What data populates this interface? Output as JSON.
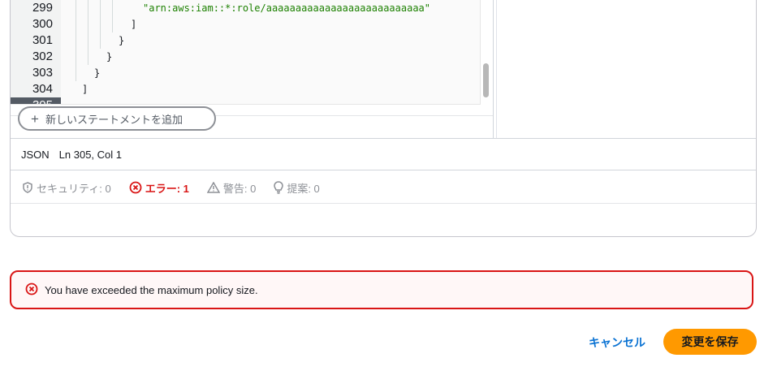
{
  "editor": {
    "line_numbers": [
      "299",
      "300",
      "301",
      "302",
      "303",
      "304",
      "305"
    ],
    "active_line": "305",
    "code_lines": [
      {
        "text": "\"arn:aws:iam::*:role/aaaaaaaaaaaaaaaaaaaaaaaaaaa\"",
        "type": "string"
      },
      {
        "text": "]",
        "type": "plain"
      },
      {
        "text": "}",
        "type": "plain"
      },
      {
        "text": "}",
        "type": "plain"
      },
      {
        "text": "}",
        "type": "plain"
      },
      {
        "text": "]",
        "type": "plain"
      },
      {
        "text": "",
        "type": "plain"
      }
    ],
    "add_statement_label": "新しいステートメントを追加"
  },
  "status_bar": {
    "language": "JSON",
    "cursor_position": "Ln 305, Col 1"
  },
  "validation": {
    "security": "セキュリティ: 0",
    "errors": "エラー: 1",
    "warnings": "警告: 0",
    "suggestions": "提案: 0"
  },
  "alert": {
    "message": "You have exceeded the maximum policy size."
  },
  "footer": {
    "cancel_label": "キャンセル",
    "save_label": "変更を保存"
  },
  "colors": {
    "error": "#d91515",
    "primary_button": "#ff9900",
    "link": "#0972d3",
    "string_literal": "#1d8102"
  }
}
